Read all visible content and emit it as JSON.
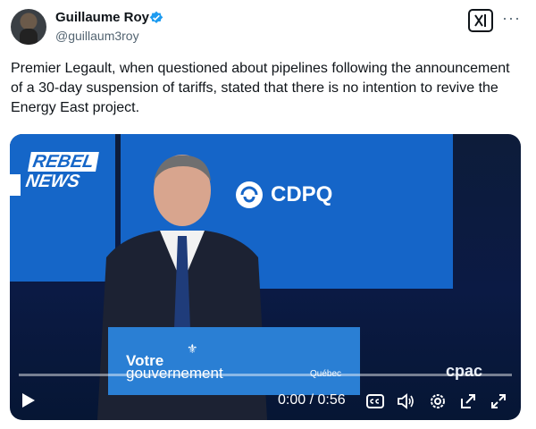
{
  "author": {
    "name": "Guillaume Roy",
    "handle": "@guillaum3roy"
  },
  "tweet": {
    "text": "Premier Legault, when questioned about pipelines following the announcement of a 30-day suspension of tariffs, stated that there is no intention to revive the Energy East project."
  },
  "video": {
    "overlay_brand": [
      "REBEL",
      "NEWS"
    ],
    "backdrop_logo": "CDPQ",
    "podium_line1": "Votre",
    "podium_line2": "gouvernement",
    "podium_sub": "Québec",
    "watermark": "cpac",
    "time": "0:00 / 0:56",
    "progress": 0
  },
  "icons": [
    "verified-icon",
    "grok-icon",
    "more-icon",
    "play-icon",
    "cc-icon",
    "volume-icon",
    "settings-icon",
    "pip-icon",
    "fullscreen-icon"
  ]
}
